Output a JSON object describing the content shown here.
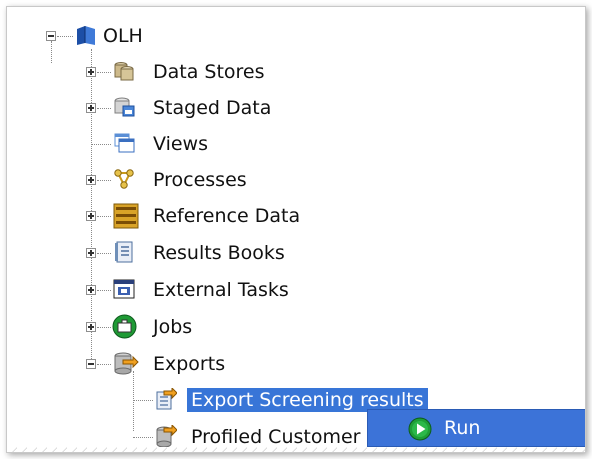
{
  "tree": {
    "root": {
      "label": "OLH",
      "icon": "project-book-icon"
    },
    "items": [
      {
        "label": "Data Stores",
        "icon": "data-stores-icon",
        "expander": "plus"
      },
      {
        "label": "Staged Data",
        "icon": "staged-data-icon",
        "expander": "plus"
      },
      {
        "label": "Views",
        "icon": "views-icon",
        "expander": "none"
      },
      {
        "label": "Processes",
        "icon": "processes-icon",
        "expander": "plus"
      },
      {
        "label": "Reference Data",
        "icon": "reference-data-icon",
        "expander": "plus"
      },
      {
        "label": "Results Books",
        "icon": "results-books-icon",
        "expander": "plus"
      },
      {
        "label": "External Tasks",
        "icon": "external-tasks-icon",
        "expander": "plus"
      },
      {
        "label": "Jobs",
        "icon": "jobs-icon",
        "expander": "plus"
      },
      {
        "label": "Exports",
        "icon": "exports-icon",
        "expander": "minus"
      }
    ],
    "children": [
      {
        "label": "Export Screening results",
        "icon": "export-results-icon",
        "selected": true
      },
      {
        "label": "Profiled Customer",
        "icon": "export-icon",
        "selected": false
      }
    ]
  },
  "context_menu": {
    "items": [
      {
        "label": "Run",
        "icon": "run-icon"
      }
    ]
  },
  "colors": {
    "selection": "#3875d7",
    "menu": "#3c73d8",
    "text": "#111111"
  }
}
